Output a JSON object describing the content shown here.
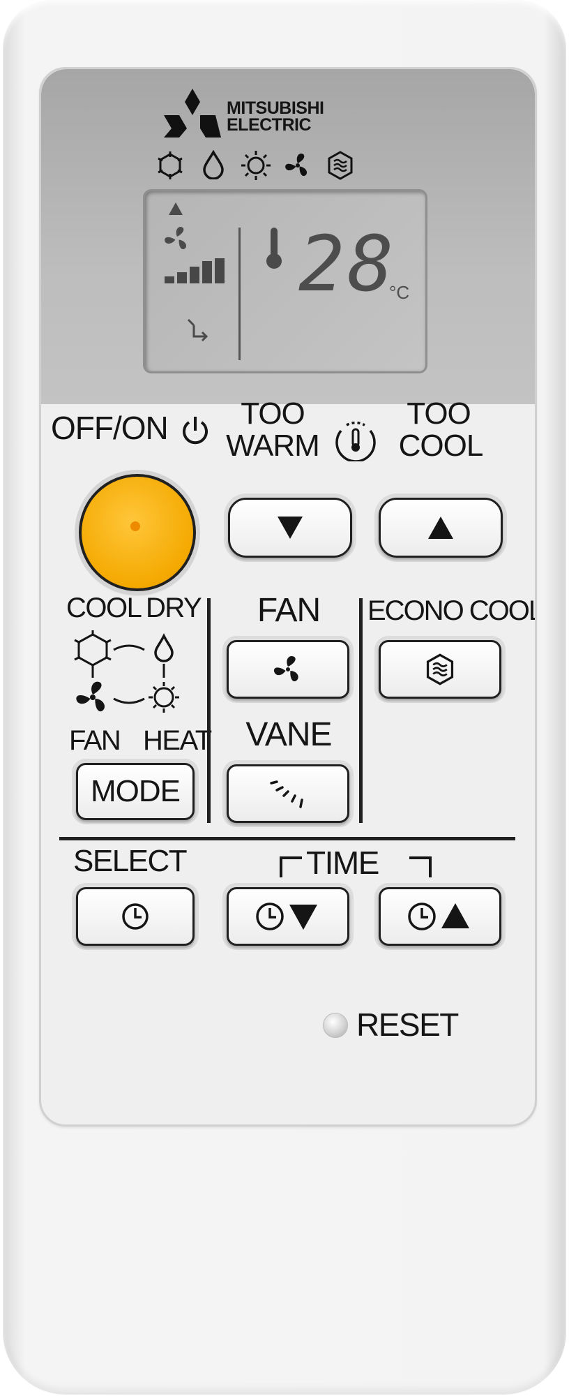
{
  "brand": {
    "name_line1": "MITSUBISHI",
    "name_line2": "ELECTRIC"
  },
  "mode_icons": [
    "cool-icon",
    "dry-icon",
    "heat-icon",
    "fan-icon",
    "econo-cool-icon"
  ],
  "display": {
    "temperature": "28",
    "unit": "°C",
    "fan_speed_level": 4,
    "fan_speed_max": 4
  },
  "controls": {
    "power_label": "OFF/ON",
    "too_warm_label_line1": "TOO",
    "too_warm_label_line2": "WARM",
    "too_cool_label_line1": "TOO",
    "too_cool_label_line2": "COOL",
    "mode_cool": "COOL",
    "mode_dry": "DRY",
    "mode_fan": "FAN",
    "mode_heat": "HEAT",
    "mode_button": "MODE",
    "fan_label": "FAN",
    "vane_label": "VANE",
    "econo_cool_label": "ECONO COOL",
    "select_label": "SELECT",
    "time_label": "TIME",
    "reset_label": "RESET"
  },
  "colors": {
    "power_button": "#f4a900",
    "panel_top": "#b3b3b3",
    "body": "#f3f3f3"
  }
}
